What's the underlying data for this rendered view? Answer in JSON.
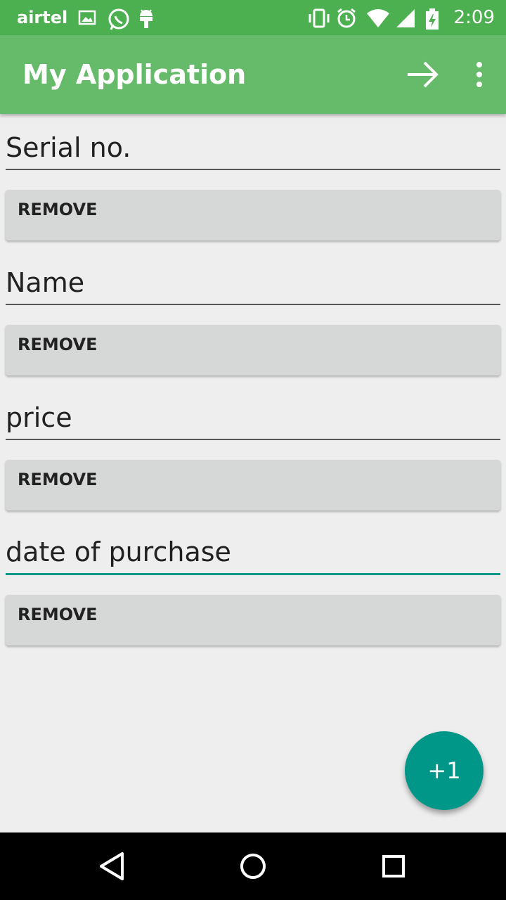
{
  "status_bar": {
    "carrier": "airtel",
    "time": "2:09",
    "icons": [
      "gallery-icon",
      "whatsapp-icon",
      "android-icon",
      "vibrate-icon",
      "alarm-icon",
      "wifi-icon",
      "signal-icon",
      "battery-charging-icon"
    ]
  },
  "app_bar": {
    "title": "My Application",
    "actions": [
      "arrow-forward-icon",
      "more-vert-icon"
    ]
  },
  "fields": [
    {
      "label": "Serial no.",
      "remove_label": "REMOVE",
      "active": false
    },
    {
      "label": "Name",
      "remove_label": "REMOVE",
      "active": false
    },
    {
      "label": "price",
      "remove_label": "REMOVE",
      "active": false
    },
    {
      "label": "date of purchase",
      "remove_label": "REMOVE",
      "active": true
    }
  ],
  "fab": {
    "label": "+1"
  },
  "nav_bar": {
    "icons": [
      "back-icon",
      "home-icon",
      "recents-icon"
    ]
  },
  "colors": {
    "status_bar": "#4caf50",
    "app_bar": "#66bb6a",
    "accent": "#009688",
    "button": "#d6d7d7",
    "background": "#eeeeee"
  }
}
